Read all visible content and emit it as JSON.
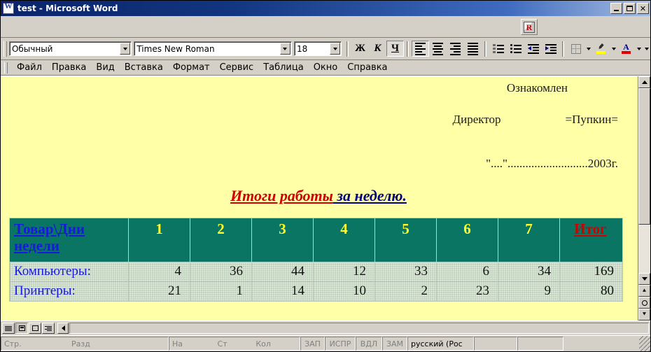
{
  "window": {
    "title": "test - Microsoft Word",
    "app_icon": "word-document-icon",
    "minimize_label": "Minimize",
    "maximize_label": "Maximize",
    "close_label": "Close"
  },
  "toolbar_top": {
    "plugin_button_label": "R"
  },
  "formatting_toolbar": {
    "style": {
      "value": "Обычный"
    },
    "font": {
      "value": "Times New Roman"
    },
    "size": {
      "value": "18"
    },
    "bold_label": "Ж",
    "italic_label": "К",
    "underline_label": "Ч",
    "align_left_label": "По левому краю",
    "align_center_label": "По центру",
    "align_right_label": "По правому краю",
    "align_justify_label": "По ширине",
    "numbered_list_label": "Нумерованный список",
    "bulleted_list_label": "Маркированный список",
    "decrease_indent_label": "Уменьшить отступ",
    "increase_indent_label": "Увеличить отступ",
    "borders_label": "Границы",
    "highlight_label": "Выделение цветом",
    "font_color_label": "Цвет шрифта",
    "more_buttons_label": "Другие кнопки"
  },
  "menubar": {
    "items": [
      {
        "label": "Файл",
        "accel": "Ф"
      },
      {
        "label": "Правка",
        "accel": "П"
      },
      {
        "label": "Вид",
        "accel": "В"
      },
      {
        "label": "Вставка",
        "accel": "а"
      },
      {
        "label": "Формат",
        "accel": "м"
      },
      {
        "label": "Сервис",
        "accel": "е"
      },
      {
        "label": "Таблица",
        "accel": "Т"
      },
      {
        "label": "Окно",
        "accel": "О"
      },
      {
        "label": "Справка",
        "accel": "С"
      }
    ]
  },
  "document": {
    "page_background": "#ffffa8",
    "header": {
      "line1": "Ознакомлен",
      "line2_label": "Директор",
      "line2_value": "=Пупкин=",
      "line3": "\"....\"...........................2003г."
    },
    "title": {
      "part_red": "Итоги работы",
      "part_blue": " за неделю.",
      "color_red": "#d00000",
      "color_blue": "#000080"
    },
    "table": {
      "header_bg": "#0a7562",
      "header_number_color": "#ffff2d",
      "header_label_color": "#1818e0",
      "total_color": "#d00000",
      "corner_label": "Товар\\Дни недели",
      "day_columns": [
        "1",
        "2",
        "3",
        "4",
        "5",
        "6",
        "7"
      ],
      "total_column": "Итог",
      "rows": [
        {
          "label": "Компьютеры:",
          "values": [
            "4",
            "36",
            "44",
            "12",
            "33",
            "6",
            "34"
          ],
          "total": "169"
        },
        {
          "label": "Принтеры:",
          "values": [
            "21",
            "1",
            "14",
            "10",
            "2",
            "23",
            "9"
          ],
          "total": "80"
        }
      ]
    }
  },
  "scrollbar": {
    "scroll_up_label": "Вверх",
    "scroll_down_label": "Вниз",
    "browse_prev_label": "Предыдущая страница",
    "browse_select_label": "Выбор объекта перехода",
    "browse_next_label": "Следующая страница"
  },
  "view_bar": {
    "normal_view_label": "Обычный режим",
    "web_view_label": "Режим веб-документа",
    "print_view_label": "Режим разметки",
    "outline_view_label": "Режим структуры",
    "scroll_left_label": "Влево"
  },
  "statusbar": {
    "page_label": "Стр.",
    "section_label": "Разд",
    "at_label": "На",
    "line_label": "Ст",
    "column_label": "Кол",
    "rec_label": "ЗАП",
    "trk_label": "ИСПР",
    "ext_label": "ВДЛ",
    "ovr_label": "ЗАМ",
    "language": "русский (Рос"
  }
}
